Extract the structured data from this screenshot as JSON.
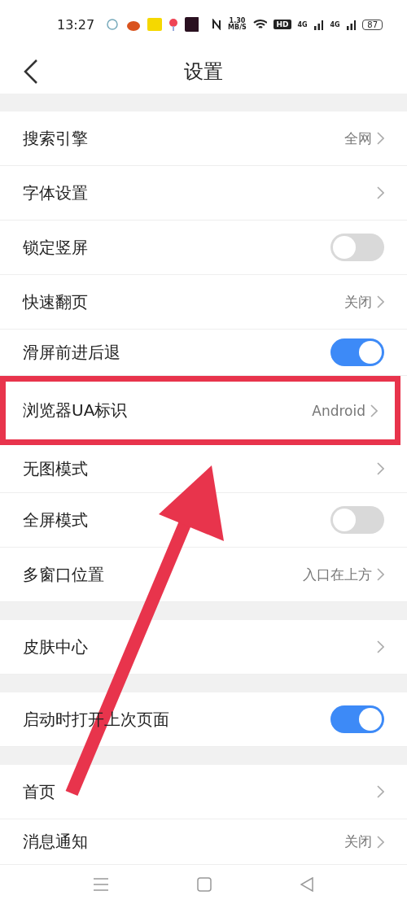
{
  "status_bar": {
    "time": "13:27",
    "speed": "1.30",
    "speed_unit": "MB/S",
    "hd": "HD",
    "networks": [
      "4G",
      "4G"
    ],
    "battery": "87"
  },
  "header": {
    "title": "设置"
  },
  "sections": [
    {
      "rows": [
        {
          "kind": "link",
          "label": "搜索引擎",
          "value": "全网",
          "highlighted": false
        },
        {
          "kind": "link",
          "label": "字体设置",
          "highlighted": false
        },
        {
          "kind": "toggle",
          "label": "锁定竖屏",
          "on": false,
          "highlighted": false
        },
        {
          "kind": "link",
          "label": "快速翻页",
          "value": "关闭",
          "highlighted": false
        },
        {
          "kind": "toggle",
          "label": "滑屏前进后退",
          "on": true,
          "highlighted": false
        },
        {
          "kind": "link",
          "label": "浏览器UA标识",
          "value": "Android",
          "highlighted": true
        },
        {
          "kind": "link",
          "label": "无图模式",
          "highlighted": false
        },
        {
          "kind": "toggle",
          "label": "全屏模式",
          "on": false,
          "highlighted": false
        },
        {
          "kind": "link",
          "label": "多窗口位置",
          "value": "入口在上方",
          "highlighted": false
        }
      ]
    },
    {
      "rows": [
        {
          "kind": "link",
          "label": "皮肤中心",
          "highlighted": false
        }
      ]
    },
    {
      "rows": [
        {
          "kind": "toggle",
          "label": "启动时打开上次页面",
          "on": true,
          "highlighted": false
        }
      ]
    },
    {
      "rows": [
        {
          "kind": "link",
          "label": "首页",
          "highlighted": false
        },
        {
          "kind": "link",
          "label": "消息通知",
          "value": "关闭",
          "highlighted": false
        }
      ]
    }
  ]
}
